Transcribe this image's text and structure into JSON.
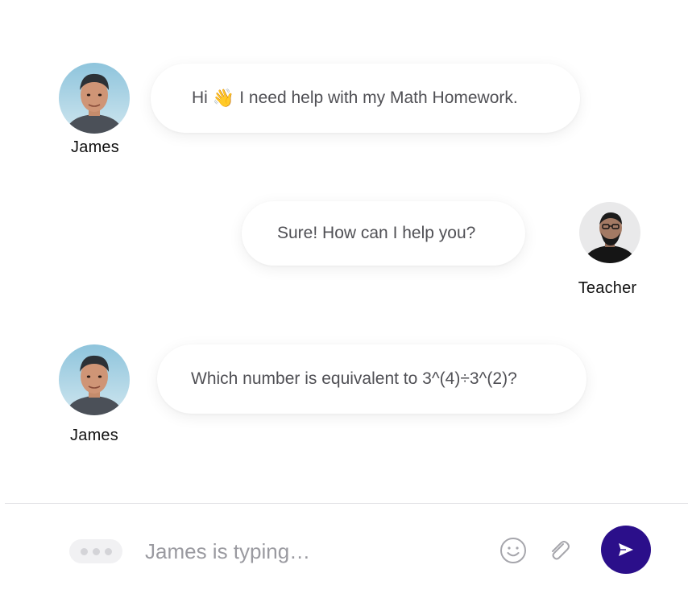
{
  "messages": [
    {
      "sender": "James",
      "text_before": "Hi",
      "emoji": "👋",
      "text_after": "I need help with my Math Homework."
    },
    {
      "sender": "Teacher",
      "text": "Sure! How can I help you?"
    },
    {
      "sender": "James",
      "text": "Which number is equivalent to 3^(4)÷3^(2)?"
    }
  ],
  "composer": {
    "placeholder": "James is typing…"
  },
  "icons": {
    "typing": "typing-indicator-icon",
    "emoji": "smiley-icon",
    "attach": "paperclip-icon",
    "send": "send-icon"
  },
  "colors": {
    "send_button": "#2b0f8a",
    "bubble_text": "#505055"
  }
}
